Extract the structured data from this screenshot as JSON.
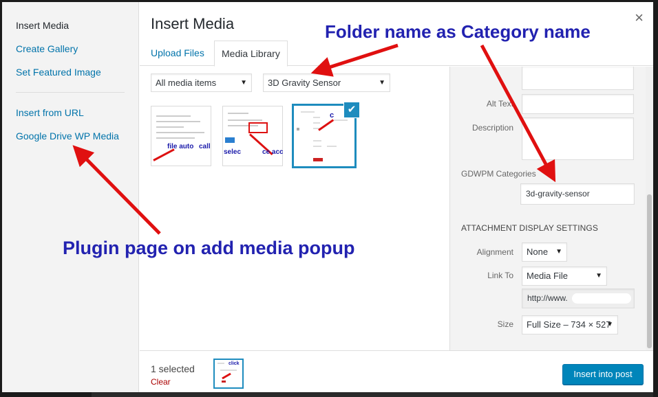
{
  "menu": {
    "items": [
      {
        "label": "Insert Media"
      },
      {
        "label": "Create Gallery"
      },
      {
        "label": "Set Featured Image"
      },
      {
        "label": "Insert from URL"
      },
      {
        "label": "Google Drive WP Media"
      }
    ]
  },
  "header": {
    "title": "Insert Media",
    "close_glyph": "×"
  },
  "tabs": [
    {
      "label": "Upload Files"
    },
    {
      "label": "Media Library"
    }
  ],
  "filters": {
    "type_select": "All media items",
    "category_select": "3D Gravity Sensor"
  },
  "thumbnails": [
    {
      "snippet": "file auto",
      "snippet2": "call"
    },
    {
      "snippet": "selec",
      "snippet2": "ce acc"
    },
    {
      "snippet": "c"
    }
  ],
  "details": {
    "alt_text_label": "Alt Text",
    "description_label": "Description",
    "categories_label": "GDWPM Categories",
    "categories_value": "3d-gravity-sensor",
    "display_heading": "Attachment Display Settings",
    "alignment_label": "Alignment",
    "alignment_value": "None",
    "link_to_label": "Link To",
    "link_to_value": "Media File",
    "url_value": "http://www.",
    "size_label": "Size",
    "size_value": "Full Size – 734 × 527"
  },
  "toolbar": {
    "selected_count": "1 selected",
    "clear_label": "Clear",
    "insert_label": "Insert into post"
  },
  "annotations": {
    "folder_note": "Folder name  as Category name",
    "plugin_note": "Plugin page on add media popup"
  },
  "colors": {
    "link": "#0073aa",
    "accent": "#1e8cbe",
    "primary_button": "#0085ba",
    "annotation_text": "#2222b0",
    "arrow": "#e01010"
  }
}
